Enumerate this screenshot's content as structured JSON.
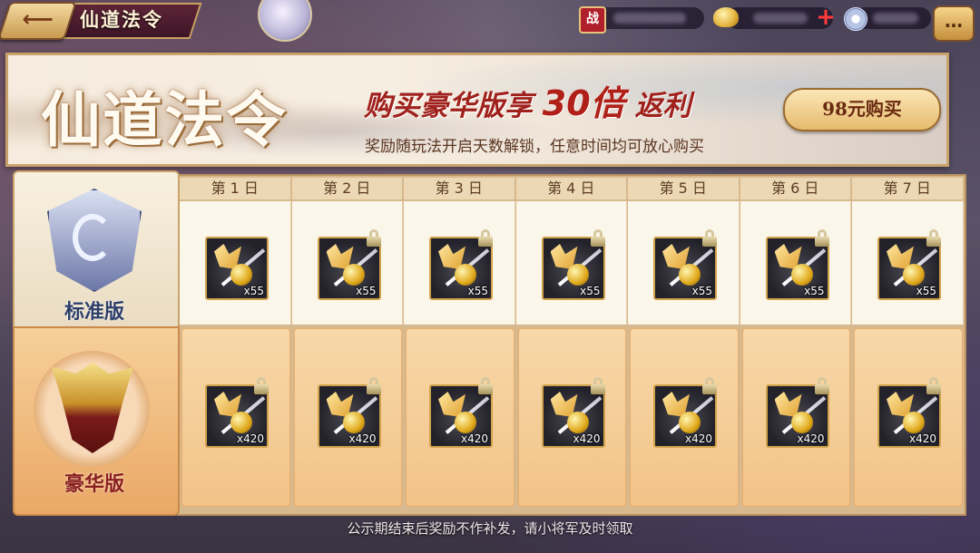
{
  "topbar": {
    "back_icon": "back-arrow-icon",
    "title": "仙道法令",
    "zhan_label": "战",
    "plus_label": "+",
    "chat_label": "…"
  },
  "banner": {
    "title": "仙道法令",
    "headline_prefix": "购买豪华版享",
    "headline_multiplier": "30倍",
    "headline_suffix": "返利",
    "subtitle": "奖励随玩法开启天数解锁，任意时间均可放心购买",
    "buy_button": "98元购买"
  },
  "tiers": {
    "standard": {
      "label": "标准版",
      "emblem_icon": "dragon-shield-emblem-icon"
    },
    "deluxe": {
      "label": "豪华版",
      "emblem_icon": "golden-beast-emblem-icon"
    }
  },
  "days": [
    "第 1 日",
    "第 2 日",
    "第 3 日",
    "第 4 日",
    "第 5 日",
    "第 6 日",
    "第 7 日"
  ],
  "standard_rewards": [
    {
      "qty": "x55",
      "locked": false
    },
    {
      "qty": "x55",
      "locked": true
    },
    {
      "qty": "x55",
      "locked": true
    },
    {
      "qty": "x55",
      "locked": true
    },
    {
      "qty": "x55",
      "locked": true
    },
    {
      "qty": "x55",
      "locked": true
    },
    {
      "qty": "x55",
      "locked": true
    }
  ],
  "deluxe_rewards": [
    {
      "qty": "x420",
      "locked": true
    },
    {
      "qty": "x420",
      "locked": true
    },
    {
      "qty": "x420",
      "locked": true
    },
    {
      "qty": "x420",
      "locked": true
    },
    {
      "qty": "x420",
      "locked": true
    },
    {
      "qty": "x420",
      "locked": true
    },
    {
      "qty": "x420",
      "locked": true
    }
  ],
  "footer_note": "公示期结束后奖励不作补发，请小将军及时领取",
  "colors": {
    "accent_red": "#a0211c",
    "gold_border": "#c9a26b",
    "deluxe_bg": "#f2c389"
  }
}
